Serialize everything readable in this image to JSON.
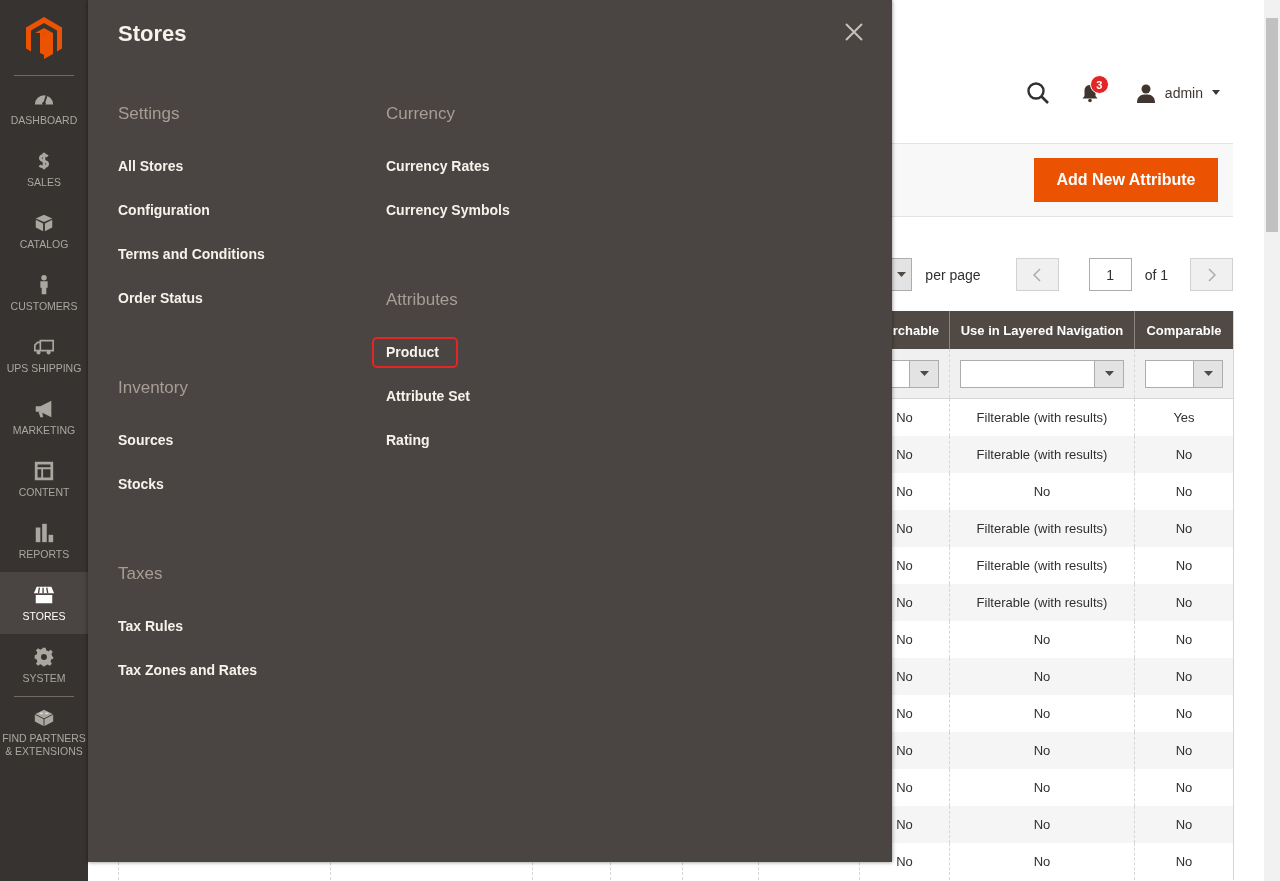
{
  "sidebar": {
    "items": [
      {
        "label": "DASHBOARD",
        "selected": false
      },
      {
        "label": "SALES",
        "selected": false
      },
      {
        "label": "CATALOG",
        "selected": false
      },
      {
        "label": "CUSTOMERS",
        "selected": false
      },
      {
        "label": "UPS SHIPPING",
        "selected": false
      },
      {
        "label": "MARKETING",
        "selected": false
      },
      {
        "label": "CONTENT",
        "selected": false
      },
      {
        "label": "REPORTS",
        "selected": false
      },
      {
        "label": "STORES",
        "selected": true
      },
      {
        "label": "SYSTEM",
        "selected": false
      },
      {
        "label": "FIND PARTNERS & EXTENSIONS",
        "selected": false
      }
    ]
  },
  "flyout": {
    "title": "Stores",
    "columns": [
      {
        "sections": [
          {
            "heading": "Settings",
            "items": [
              {
                "label": "All Stores",
                "highlighted": false
              },
              {
                "label": "Configuration",
                "highlighted": false
              },
              {
                "label": "Terms and Conditions",
                "highlighted": false
              },
              {
                "label": "Order Status",
                "highlighted": false
              }
            ]
          },
          {
            "heading": "Inventory",
            "items": [
              {
                "label": "Sources",
                "highlighted": false
              },
              {
                "label": "Stocks",
                "highlighted": false
              }
            ]
          },
          {
            "heading": "Taxes",
            "items": [
              {
                "label": "Tax Rules",
                "highlighted": false
              },
              {
                "label": "Tax Zones and Rates",
                "highlighted": false
              }
            ]
          }
        ]
      },
      {
        "sections": [
          {
            "heading": "Currency",
            "items": [
              {
                "label": "Currency Rates",
                "highlighted": false
              },
              {
                "label": "Currency Symbols",
                "highlighted": false
              }
            ]
          },
          {
            "heading": "Attributes",
            "items": [
              {
                "label": "Product",
                "highlighted": true
              },
              {
                "label": "Attribute Set",
                "highlighted": false
              },
              {
                "label": "Rating",
                "highlighted": false
              }
            ]
          }
        ]
      }
    ]
  },
  "header": {
    "notification_count": "3",
    "user": "admin"
  },
  "actions": {
    "primary_button": "Add New Attribute"
  },
  "pager": {
    "per_page_label": "per page",
    "page": "1",
    "total": "of 1"
  },
  "table": {
    "columns": [
      "rchable",
      "Use in Layered Navigation",
      "Comparable"
    ],
    "rows": [
      {
        "cells": [
          "No",
          "Filterable (with results)",
          "Yes"
        ]
      },
      {
        "cells": [
          "No",
          "Filterable (with results)",
          "No"
        ]
      },
      {
        "cells": [
          "No",
          "No",
          "No"
        ]
      },
      {
        "cells": [
          "No",
          "Filterable (with results)",
          "No"
        ]
      },
      {
        "cells": [
          "No",
          "Filterable (with results)",
          "No"
        ]
      },
      {
        "cells": [
          "No",
          "Filterable (with results)",
          "No"
        ]
      },
      {
        "cells": [
          "No",
          "No",
          "No"
        ]
      },
      {
        "cells": [
          "No",
          "No",
          "No"
        ]
      },
      {
        "cells": [
          "No",
          "No",
          "No"
        ]
      },
      {
        "cells": [
          "No",
          "No",
          "No"
        ]
      },
      {
        "cells": [
          "No",
          "No",
          "No"
        ]
      },
      {
        "cells": [
          "No",
          "No",
          "No"
        ]
      },
      {
        "cells": [
          "No",
          "No",
          "No"
        ]
      }
    ]
  }
}
